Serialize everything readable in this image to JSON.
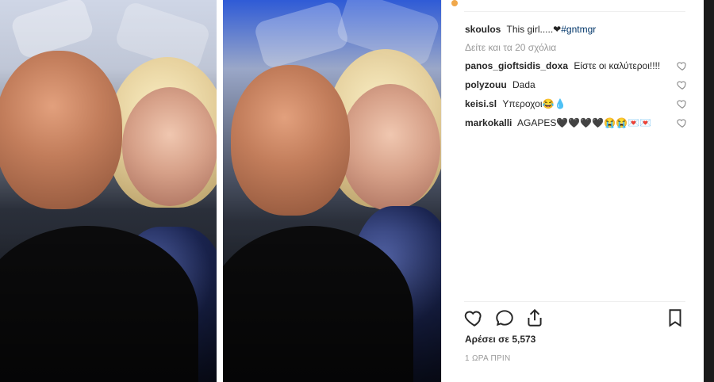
{
  "post": {
    "caption": {
      "username": "skoulos",
      "text": "This girl.....❤",
      "hashtag": "#gntmgr"
    },
    "view_more": "Δείτε και τα 20 σχόλια",
    "comments": [
      {
        "username": "panos_gioftsidis_doxa",
        "text": "Είστε οι καλύτεροι!!!!"
      },
      {
        "username": "polyzouu",
        "text": "Dada"
      },
      {
        "username": "keisi.sl",
        "text": "Υπεροχοι😂💧"
      },
      {
        "username": "markokalli",
        "text": "AGAPES🖤🖤🖤🖤😭😭💌💌"
      }
    ],
    "likes": "Αρέσει σε 5,573",
    "time": "1 ΩΡΑ ΠΡΙΝ"
  },
  "icons": {
    "like": "heart-icon",
    "comment": "comment-icon",
    "share": "share-icon",
    "save": "bookmark-icon",
    "comment_like": "heart-outline-icon"
  },
  "colors": {
    "text": "#262626",
    "muted": "#999999",
    "link": "#003569",
    "rule": "#efefef",
    "backdrop": "#1f1f1f"
  }
}
